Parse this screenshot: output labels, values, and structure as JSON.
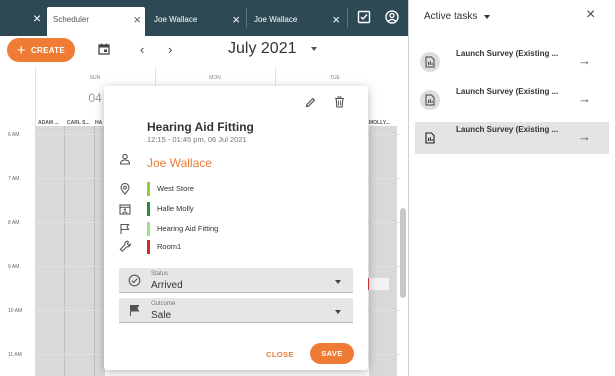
{
  "tabs": [
    {
      "label": "Scheduler",
      "active": true
    },
    {
      "label": "Joe Wallace",
      "active": false
    },
    {
      "label": "Joe Wallace",
      "active": false
    }
  ],
  "toolbar": {
    "create_label": "CREATE",
    "month": "July 2021"
  },
  "calendar": {
    "days": [
      {
        "weekday": "SUN",
        "date": "04"
      },
      {
        "weekday": "MON",
        "date": ""
      },
      {
        "weekday": "TUE",
        "date": ""
      }
    ],
    "hours": [
      "6 AM",
      "7 AM",
      "8 AM",
      "9 AM",
      "10 AM",
      "11 AM"
    ],
    "resources": [
      "ADAM ...",
      "CARL S...",
      "HA",
      "MOLLY..."
    ]
  },
  "appointment": {
    "title": "Hearing Aid Fitting",
    "time": "12:15 - 01:45 pm, 06 Jul 2021",
    "customer": "Joe Wallace",
    "details": [
      {
        "icon": "location-icon",
        "text": "West Store",
        "color": "#8bd13b"
      },
      {
        "icon": "calendar-person-icon",
        "text": "Halle Molly",
        "color": "#2e8b3a"
      },
      {
        "icon": "flag-icon",
        "text": "Hearing Aid Fitting",
        "color": "#9be08a"
      },
      {
        "icon": "wrench-icon",
        "text": "Room1",
        "color": "#d42a2a"
      }
    ],
    "status": {
      "label": "Status",
      "value": "Arrived"
    },
    "outcome": {
      "label": "Outcome",
      "value": "Sale"
    },
    "close_label": "CLOSE",
    "save_label": "SAVE"
  },
  "panel": {
    "title": "Active tasks",
    "tasks": [
      {
        "label": "Launch Survey (Existing ...",
        "selected": false
      },
      {
        "label": "Launch Survey (Existing ...",
        "selected": false
      },
      {
        "label": "Launch Survey (Existing ...",
        "selected": true
      }
    ]
  },
  "colors": {
    "accent": "#f07b34",
    "header": "#2d4a54"
  }
}
